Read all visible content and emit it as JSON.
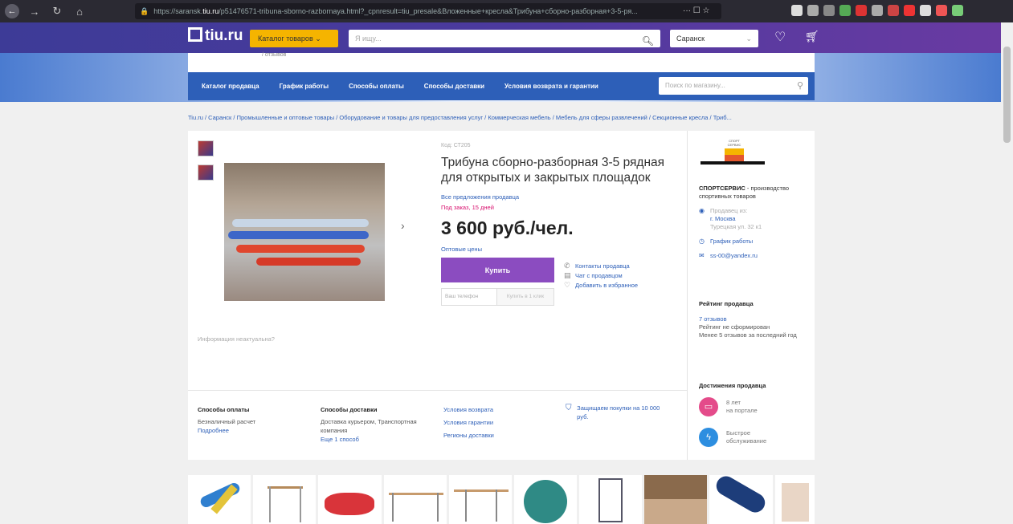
{
  "browser": {
    "url_prefix": "https://saransk.",
    "url_host": "tiu.ru",
    "url_rest": "/p51476571-tribuna-sborno-razbornaya.html?_cpnresult=tiu_presale&Вложенные+кресла&Трибуна+сборно-разборная+3-5-ря...",
    "url_end": "··· ☐ ☆"
  },
  "header": {
    "logo": "tiu.ru",
    "catalog_label": "Каталог товаров",
    "search_placeholder": "Я ищу...",
    "city": "Саранск"
  },
  "store": {
    "banner_sub": "/ отзывов",
    "nav": [
      "Каталог продавца",
      "График работы",
      "Способы оплаты",
      "Способы доставки",
      "Условия возврата и гарантии"
    ],
    "search_placeholder": "Поиск по магазину..."
  },
  "breadcrumbs": "Tiu.ru / Саранск / Промышленные и оптовые товары / Оборудование и товары для предоставления услуг / Коммерческая мебель / Мебель для сферы развлечений / Секционные кресла / Триб...",
  "product": {
    "code": "Код: СТ205",
    "title": "Трибуна сборно-разборная 3-5 рядная для открытых и закрытых площадок",
    "all_offers": "Все предложения продавца",
    "order_note": "Под заказ, 15 дней",
    "price": "3 600 руб./чел.",
    "wholesale": "Оптовые цены",
    "buy": "Купить",
    "phone_placeholder": "Ваш телефон",
    "one_click": "Купить в 1 клик",
    "actions": [
      "Контакты продавца",
      "Чат с продавцом",
      "Добавить в избранное"
    ],
    "info_incorrect": "Информация неактуальна?"
  },
  "seller": {
    "logo_text": "СПОРТ СЕРВИС",
    "name": "СПОРТСЕРВИС",
    "name_suffix": " - производство спортивных товаров",
    "seller_from_label": "Продавец из:",
    "city": "г. Москва",
    "address": "Турецкая ул. 32 к1",
    "schedule": "График работы",
    "email": "ss-00@yandex.ru",
    "rating_title": "Рейтинг продавца",
    "reviews": "7 отзывов",
    "rating_status": "Рейтинг не сформирован",
    "rating_note": "Менее 5 отзывов за последний год",
    "achievements_title": "Достижения продавца",
    "achievements": [
      {
        "line1": "8 лет",
        "line2": "на портале",
        "color": "#e44b8a"
      },
      {
        "line1": "Быстрое",
        "line2": "обслуживание",
        "color": "#2d8ee0"
      }
    ]
  },
  "footer_info": {
    "payment_title": "Способы оплаты",
    "payment_text": "Безналичный расчет",
    "payment_more": "Подробнее",
    "delivery_title": "Способы доставки",
    "delivery_text": "Доставка курьером, Транспортная компания",
    "delivery_more": "Еще 1 способ",
    "links": [
      "Условия возврата",
      "Условия гарантии",
      "Регионы доставки"
    ],
    "protect": "Защищаем покупки на 10 000 руб."
  },
  "colors": {
    "accent": "#8b4cc0",
    "header": "#4c3a9e",
    "store_nav": "#2d5fb8",
    "catalog_btn": "#f5b400",
    "order_note": "#d8126f"
  },
  "icons": {
    "back": "back-icon",
    "forward": "forward-icon",
    "reload": "reload-icon",
    "home": "home-icon",
    "search": "search-icon",
    "heart": "heart-icon",
    "cart": "cart-icon"
  }
}
